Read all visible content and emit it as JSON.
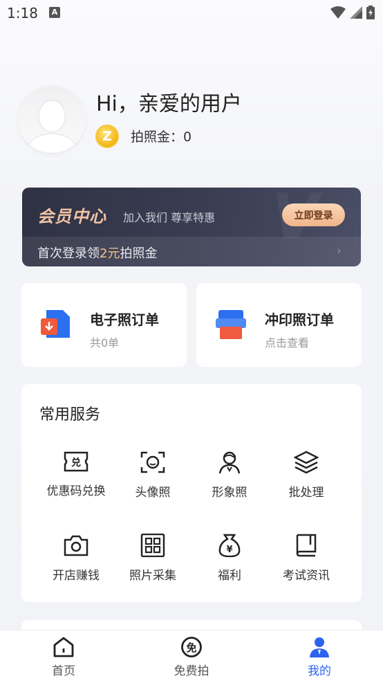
{
  "status_bar": {
    "time": "1:18",
    "notification_icon": "A"
  },
  "profile": {
    "greeting": "Hi，亲爱的用户",
    "coin_label": "拍照金：0",
    "coin_icon": "Z"
  },
  "vip": {
    "title": "会员中心",
    "subtitle": "加入我们 尊享特惠",
    "login_button": "立即登录",
    "promo_prefix": "首次登录领",
    "promo_highlight": "2元",
    "promo_suffix": "拍照金"
  },
  "orders": [
    {
      "title": "电子照订单",
      "subtitle": "共0单"
    },
    {
      "title": "冲印照订单",
      "subtitle": "点击查看"
    }
  ],
  "services": {
    "title": "常用服务",
    "items": [
      {
        "label": "优惠码兑换",
        "icon": "coupon-icon"
      },
      {
        "label": "头像照",
        "icon": "face-scan-icon"
      },
      {
        "label": "形象照",
        "icon": "person-icon"
      },
      {
        "label": "批处理",
        "icon": "layers-icon"
      },
      {
        "label": "开店赚钱",
        "icon": "camera-icon"
      },
      {
        "label": "照片采集",
        "icon": "grid-icon"
      },
      {
        "label": "福利",
        "icon": "money-bag-icon"
      },
      {
        "label": "考试资讯",
        "icon": "book-icon"
      }
    ]
  },
  "nav": {
    "items": [
      {
        "label": "首页",
        "icon": "home-icon"
      },
      {
        "label": "免费拍",
        "icon": "free-icon"
      },
      {
        "label": "我的",
        "icon": "user-icon"
      }
    ],
    "active_color": "#2c63f1"
  },
  "colors": {
    "vip_bg": "#3c3f55",
    "vip_accent": "#f1c4a4",
    "primary": "#2c63f1"
  }
}
